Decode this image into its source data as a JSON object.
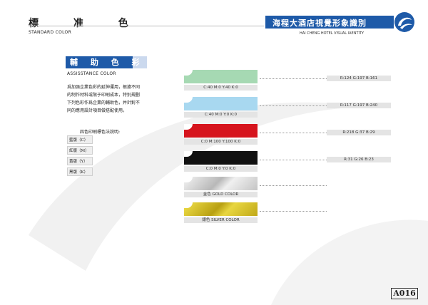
{
  "header": {
    "title_cn": "標 准 色",
    "title_en": "STANDARD COLOR",
    "banner_cn": "海程大酒店視覺形象識別",
    "banner_en": "HAI CHENG HOTEL VISUAL IAENTITY",
    "logo_icon": "swirl-logo-icon",
    "accent_color": "#1e5aa8"
  },
  "section": {
    "title_cn": "輔 助 色 彩",
    "title_en": "ASSISSTANCE  COLOR",
    "description": "爲加强企業色彩的延伸運用，根據不同的制作材料或限于印刷成本，特别規劃下列色彩作爲企業的輔助色，并針對不同的應用設計項目做搭配使用。",
    "print_title": "四色印刷標色法說明:",
    "plates": [
      "藍版（C）",
      "紅版（M）",
      "黄版（Y）",
      "黑版（K）"
    ]
  },
  "swatches": [
    {
      "color": "#a6d9b3",
      "caption": "C:40  M:0  Y:40  K:0",
      "rgb": "R:124  G:197  B:161"
    },
    {
      "color": "#a8d8f0",
      "caption": "C:40  M:0  Y:0  K:0",
      "rgb": "R:117  G:197  B:240"
    },
    {
      "color": "#d6141d",
      "caption": "C:0  M:100  Y:100  K:0",
      "rgb": "R:218  G:37  B:29"
    },
    {
      "color": "#111111",
      "caption": "C:0  M:0  Y:0  K:0",
      "rgb": "R:31  G:26  B:23"
    },
    {
      "color": "#d8d8d8",
      "caption": "金色    GOLD COLOR",
      "rgb": ""
    },
    {
      "color": "#d8c020",
      "caption": "銀色    SILVER COLOR",
      "rgb": ""
    }
  ],
  "footer": {
    "page_number": "A016"
  }
}
